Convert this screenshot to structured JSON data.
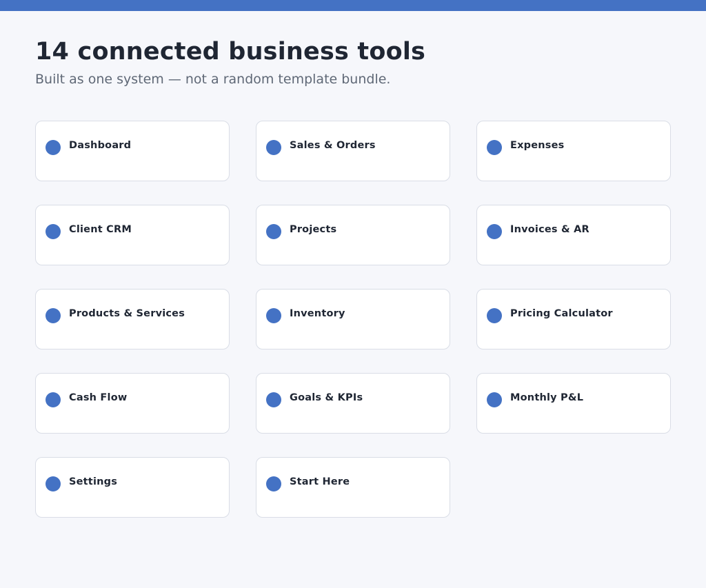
{
  "colors": {
    "accent": "#4472c4",
    "background": "#f6f7fb",
    "card_border": "#d9dde6",
    "title": "#1f2633",
    "subtitle": "#5f6876"
  },
  "header": {
    "title": "14 connected business tools",
    "subtitle": "Built as one system — not a random template bundle."
  },
  "tools": [
    {
      "label": "Dashboard",
      "icon": "dot-icon"
    },
    {
      "label": "Sales & Orders",
      "icon": "dot-icon"
    },
    {
      "label": "Expenses",
      "icon": "dot-icon"
    },
    {
      "label": "Client CRM",
      "icon": "dot-icon"
    },
    {
      "label": "Projects",
      "icon": "dot-icon"
    },
    {
      "label": "Invoices & AR",
      "icon": "dot-icon"
    },
    {
      "label": "Products & Services",
      "icon": "dot-icon"
    },
    {
      "label": "Inventory",
      "icon": "dot-icon"
    },
    {
      "label": "Pricing Calculator",
      "icon": "dot-icon"
    },
    {
      "label": "Cash Flow",
      "icon": "dot-icon"
    },
    {
      "label": "Goals & KPIs",
      "icon": "dot-icon"
    },
    {
      "label": "Monthly P&L",
      "icon": "dot-icon"
    },
    {
      "label": "Settings",
      "icon": "dot-icon"
    },
    {
      "label": "Start Here",
      "icon": "dot-icon"
    }
  ]
}
